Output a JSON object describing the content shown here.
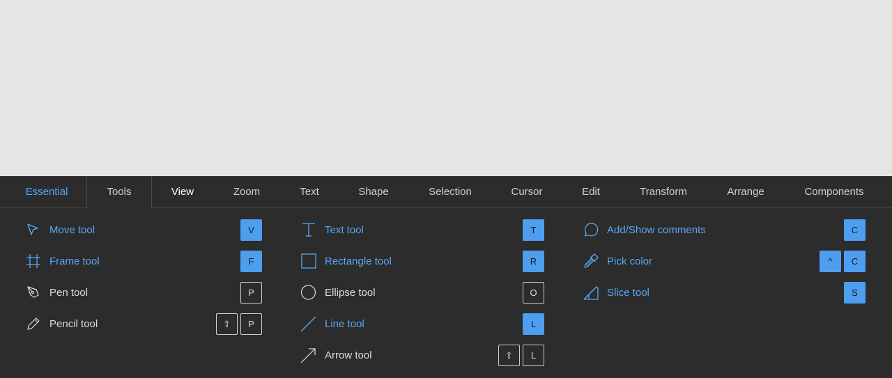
{
  "tabs": [
    {
      "label": "Essential"
    },
    {
      "label": "Tools"
    },
    {
      "label": "View"
    },
    {
      "label": "Zoom"
    },
    {
      "label": "Text"
    },
    {
      "label": "Shape"
    },
    {
      "label": "Selection"
    },
    {
      "label": "Cursor"
    },
    {
      "label": "Edit"
    },
    {
      "label": "Transform"
    },
    {
      "label": "Arrange"
    },
    {
      "label": "Components"
    }
  ],
  "columns": [
    {
      "items": [
        {
          "label": "Move tool",
          "icon": "move-cursor-icon",
          "active": true,
          "keys": [
            "V"
          ]
        },
        {
          "label": "Frame tool",
          "icon": "frame-icon",
          "active": true,
          "keys": [
            "F"
          ]
        },
        {
          "label": "Pen tool",
          "icon": "pen-icon",
          "active": false,
          "keys": [
            "P"
          ]
        },
        {
          "label": "Pencil tool",
          "icon": "pencil-icon",
          "active": false,
          "keys": [
            "⇧",
            "P"
          ]
        }
      ]
    },
    {
      "items": [
        {
          "label": "Text tool",
          "icon": "text-icon",
          "active": true,
          "keys": [
            "T"
          ]
        },
        {
          "label": "Rectangle tool",
          "icon": "rectangle-icon",
          "active": true,
          "keys": [
            "R"
          ]
        },
        {
          "label": "Ellipse tool",
          "icon": "ellipse-icon",
          "active": false,
          "keys": [
            "O"
          ]
        },
        {
          "label": "Line tool",
          "icon": "line-icon",
          "active": true,
          "keys": [
            "L"
          ]
        },
        {
          "label": "Arrow tool",
          "icon": "arrow-icon",
          "active": false,
          "keys": [
            "⇧",
            "L"
          ]
        }
      ]
    },
    {
      "items": [
        {
          "label": "Add/Show comments",
          "icon": "comment-icon",
          "active": true,
          "keys": [
            "C"
          ]
        },
        {
          "label": "Pick color",
          "icon": "eyedropper-icon",
          "active": true,
          "keys": [
            "^",
            "C"
          ]
        },
        {
          "label": "Slice tool",
          "icon": "slice-icon",
          "active": true,
          "keys": [
            "S"
          ]
        }
      ]
    }
  ],
  "colors": {
    "active": "#59a8f5",
    "panel": "#2c2c2c",
    "canvas": "#e5e5e5"
  }
}
